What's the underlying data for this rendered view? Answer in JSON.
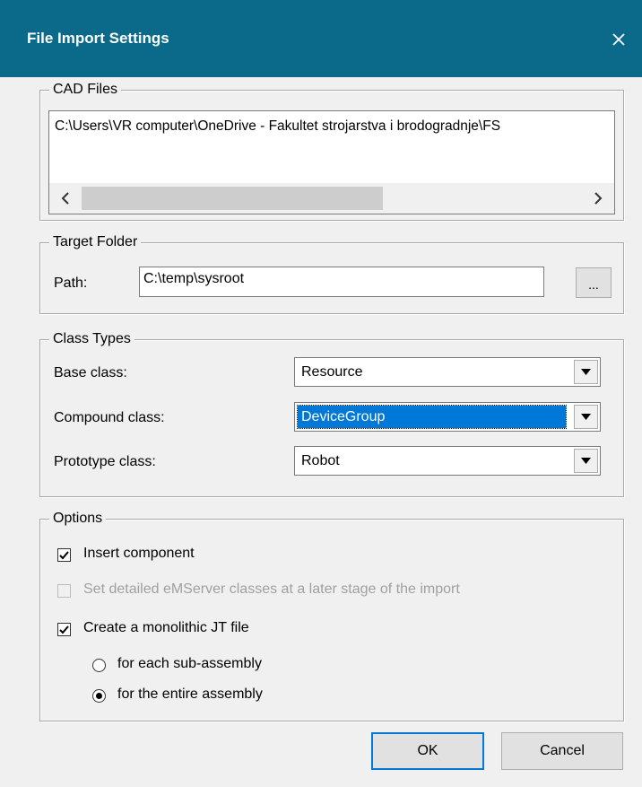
{
  "window": {
    "title": "File Import Settings",
    "close_icon": "close-icon"
  },
  "cad_files": {
    "group_label": "CAD Files",
    "entry": "C:\\Users\\VR computer\\OneDrive - Fakultet strojarstva i brodogradnje\\FS",
    "scroll_left": "<",
    "scroll_right": ">"
  },
  "target_folder": {
    "group_label": "Target Folder",
    "path_label": "Path:",
    "path_value": "C:\\temp\\sysroot",
    "browse_label": "..."
  },
  "class_types": {
    "group_label": "Class Types",
    "base_label": "Base class:",
    "base_value": "Resource",
    "compound_label": "Compound class:",
    "compound_value": "DeviceGroup",
    "prototype_label": "Prototype class:",
    "prototype_value": "Robot"
  },
  "options": {
    "group_label": "Options",
    "insert_component": {
      "label": "Insert component",
      "checked": true
    },
    "set_detailed": {
      "label": "Set detailed eMServer classes at a later stage of the import",
      "checked": false,
      "disabled": true
    },
    "monolithic": {
      "label": "Create a monolithic JT file",
      "checked": true
    },
    "radio_sub": {
      "label": "for each sub-assembly",
      "selected": false
    },
    "radio_entire": {
      "label": "for the entire assembly",
      "selected": true
    }
  },
  "buttons": {
    "ok": "OK",
    "cancel": "Cancel"
  },
  "colors": {
    "titlebar": "#0b6a8a",
    "selection": "#0078d7",
    "dialog_bg": "#f0f0f0"
  }
}
